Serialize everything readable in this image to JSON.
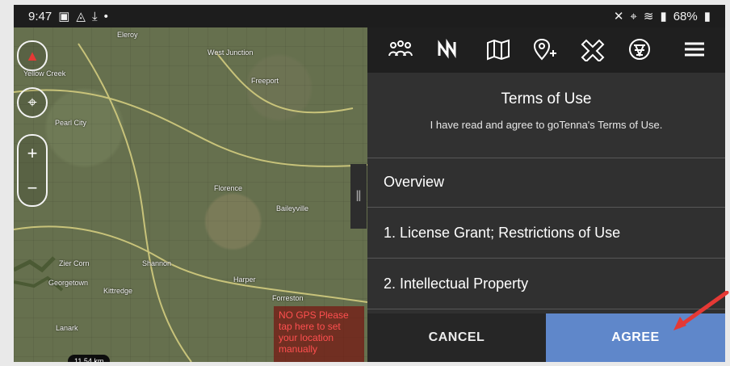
{
  "status_bar": {
    "time": "9:47",
    "left_icons": [
      "image-icon",
      "drive-icon",
      "download-icon",
      "dot-icon"
    ],
    "right_icons": [
      "mute-icon",
      "location-icon",
      "wifi-icon",
      "signal-icon",
      "battery-icon"
    ],
    "battery": "68%"
  },
  "map": {
    "labels": [
      "Eleroy",
      "Yellow Creek",
      "West Junction",
      "Freeport",
      "Pearl City",
      "Florence",
      "Baileyville",
      "Zier Corn",
      "Shannon",
      "Georgetown",
      "Kittredge",
      "Harper",
      "Forreston",
      "Lanark"
    ],
    "scale": "11.54 km",
    "no_gps": "NO GPS Please tap here to set your location manually"
  },
  "toolbar": {
    "icons": [
      "team-icon",
      "wave-icon",
      "map-icon",
      "add-location-icon",
      "cross-icon",
      "network-icon",
      "menu-icon"
    ]
  },
  "terms": {
    "title": "Terms of Use",
    "subtitle": "I have read and agree to goTenna's Terms of Use.",
    "items": [
      "Overview",
      "1. License Grant; Restrictions of Use",
      "2. Intellectual Property"
    ]
  },
  "actions": {
    "cancel": "CANCEL",
    "agree": "AGREE"
  },
  "colors": {
    "accent": "#5f87ca",
    "alert": "#ff4f4f",
    "annotation": "#e53935"
  }
}
